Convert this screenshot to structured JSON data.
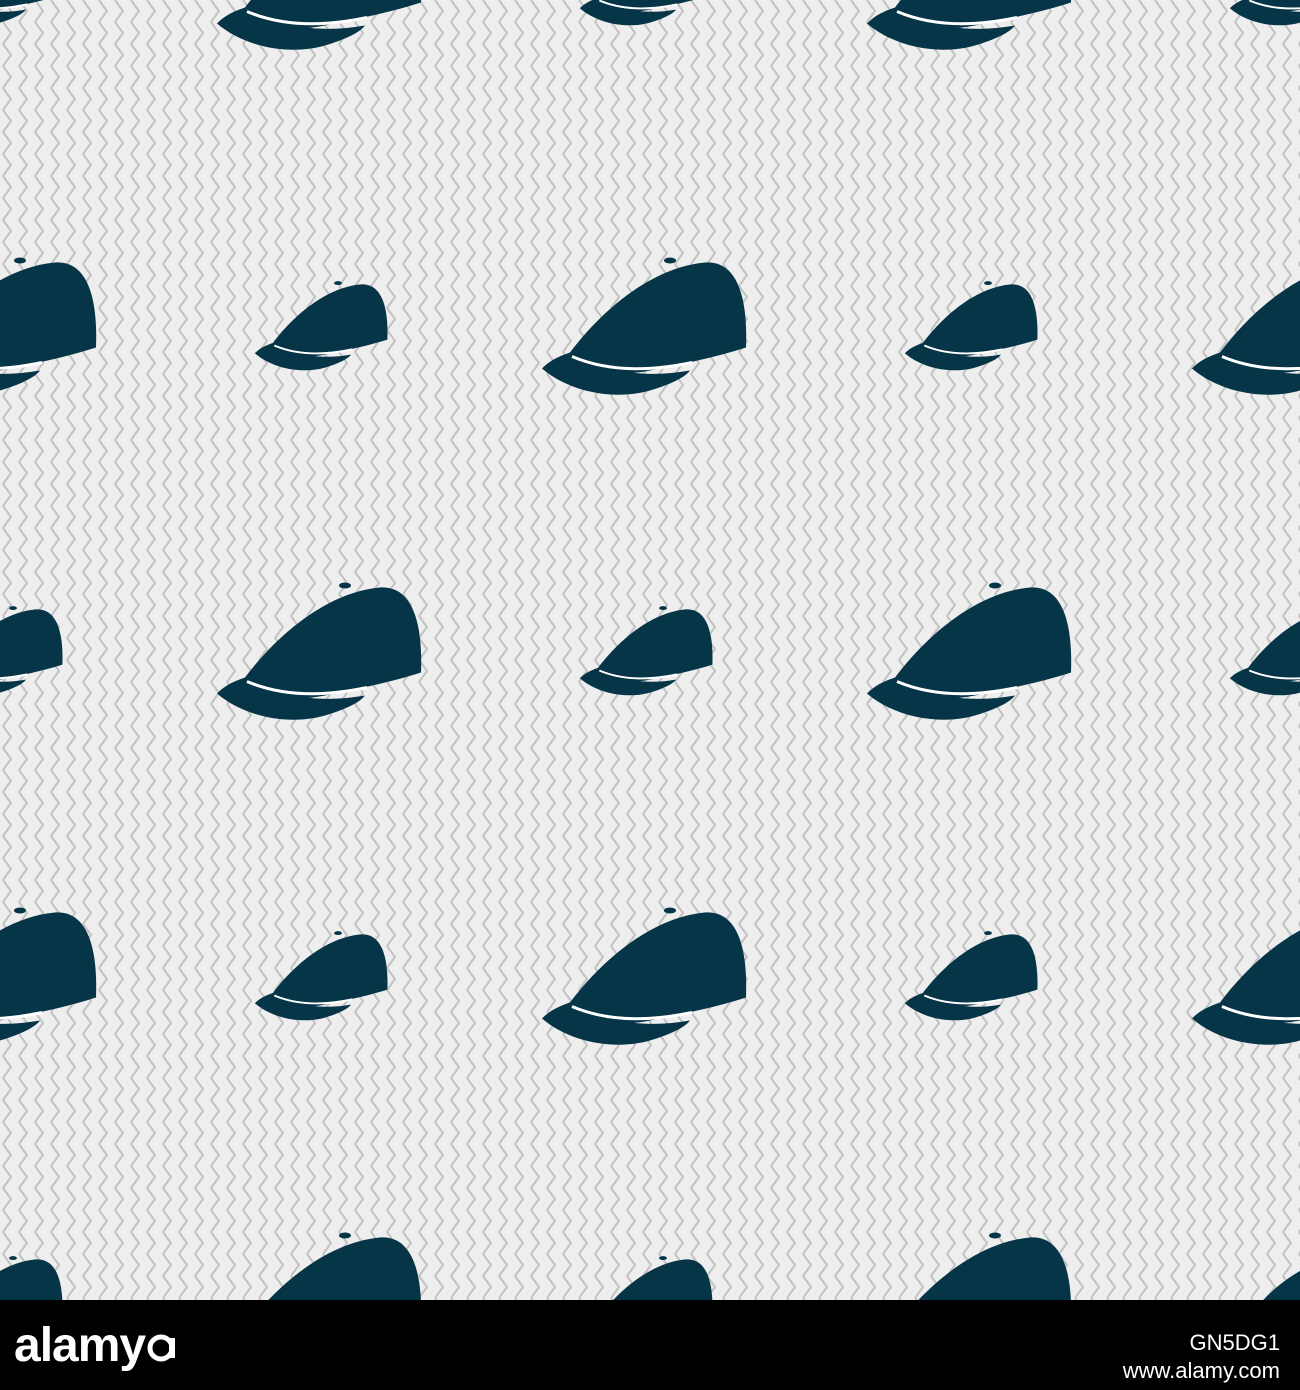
{
  "pattern": {
    "icon_name": "baseball-cap-icon",
    "cap_color": "#073548",
    "background_color": "#eeeeee",
    "zigzag_color": "#bdbdbd"
  },
  "footer": {
    "logo_text": "alamy",
    "logo_mark": "a-logo-mark",
    "image_id": "GN5DG1",
    "site": "www.alamy.com",
    "background_color": "#000000",
    "text_color": "#ffffff"
  }
}
